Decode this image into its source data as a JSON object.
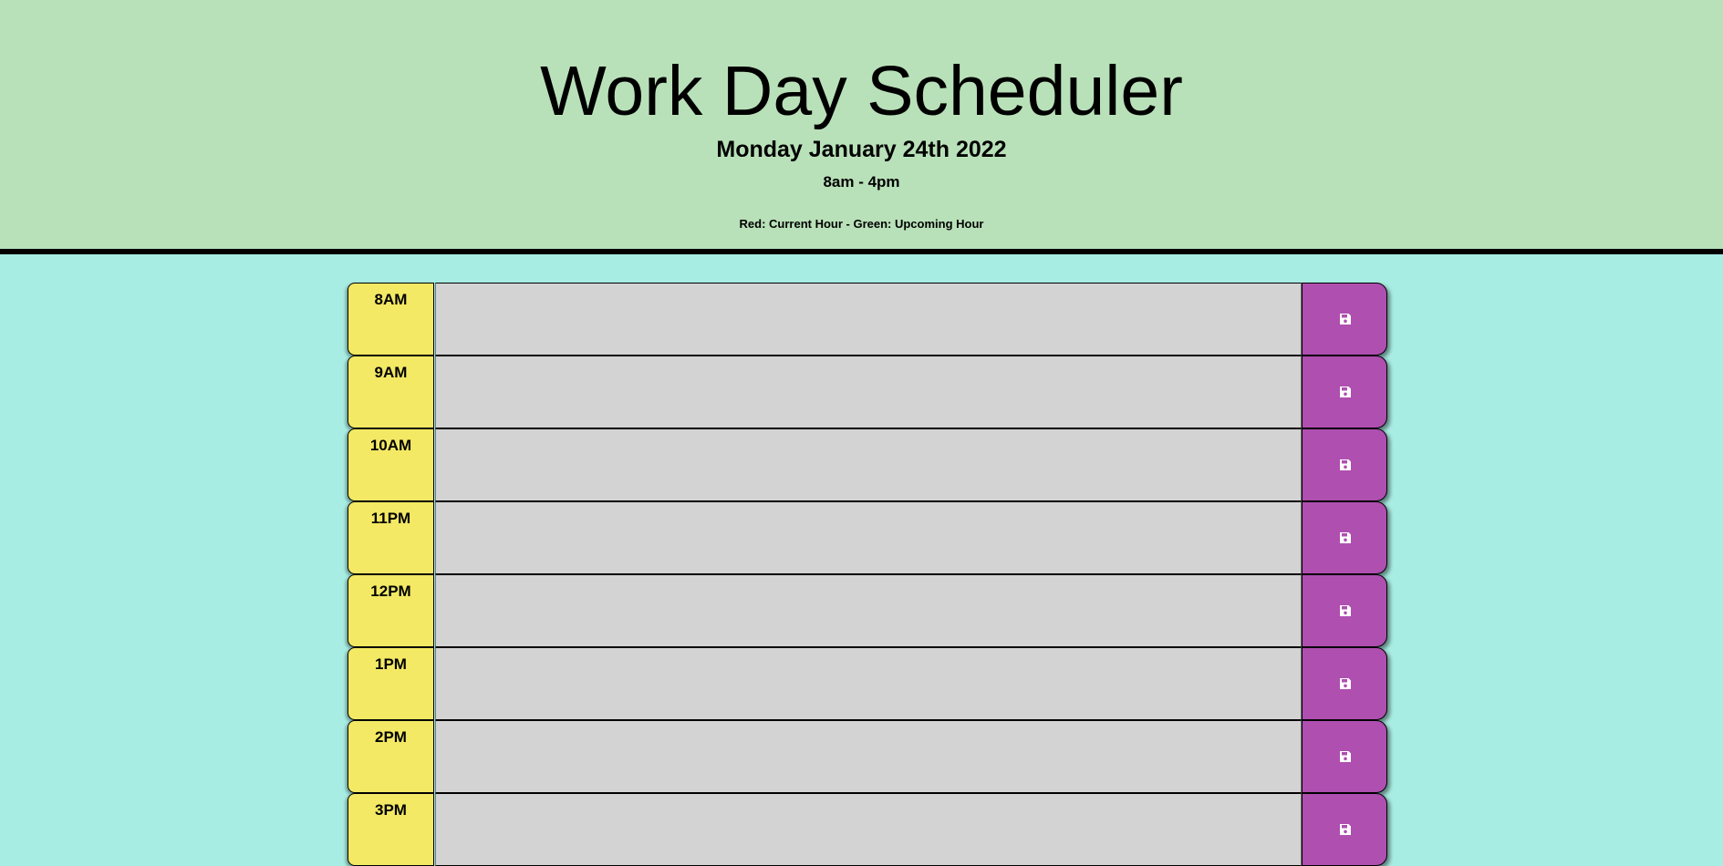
{
  "header": {
    "title": "Work Day Scheduler",
    "date": "Monday January 24th 2022",
    "hours": "8am - 4pm",
    "legend": "Red: Current Hour - Green: Upcoming Hour"
  },
  "colors": {
    "header_bg": "#b9e1b9",
    "page_bg": "#a8ede3",
    "hour_bg": "#f3e964",
    "task_bg": "#d3d3d3",
    "save_bg": "#af4fb0"
  },
  "rows": [
    {
      "hour": "8AM",
      "task": "",
      "save_icon": "floppy-disk-icon"
    },
    {
      "hour": "9AM",
      "task": "",
      "save_icon": "floppy-disk-icon"
    },
    {
      "hour": "10AM",
      "task": "",
      "save_icon": "floppy-disk-icon"
    },
    {
      "hour": "11PM",
      "task": "",
      "save_icon": "floppy-disk-icon"
    },
    {
      "hour": "12PM",
      "task": "",
      "save_icon": "floppy-disk-icon"
    },
    {
      "hour": "1PM",
      "task": "",
      "save_icon": "floppy-disk-icon"
    },
    {
      "hour": "2PM",
      "task": "",
      "save_icon": "floppy-disk-icon"
    },
    {
      "hour": "3PM",
      "task": "",
      "save_icon": "floppy-disk-icon"
    }
  ]
}
